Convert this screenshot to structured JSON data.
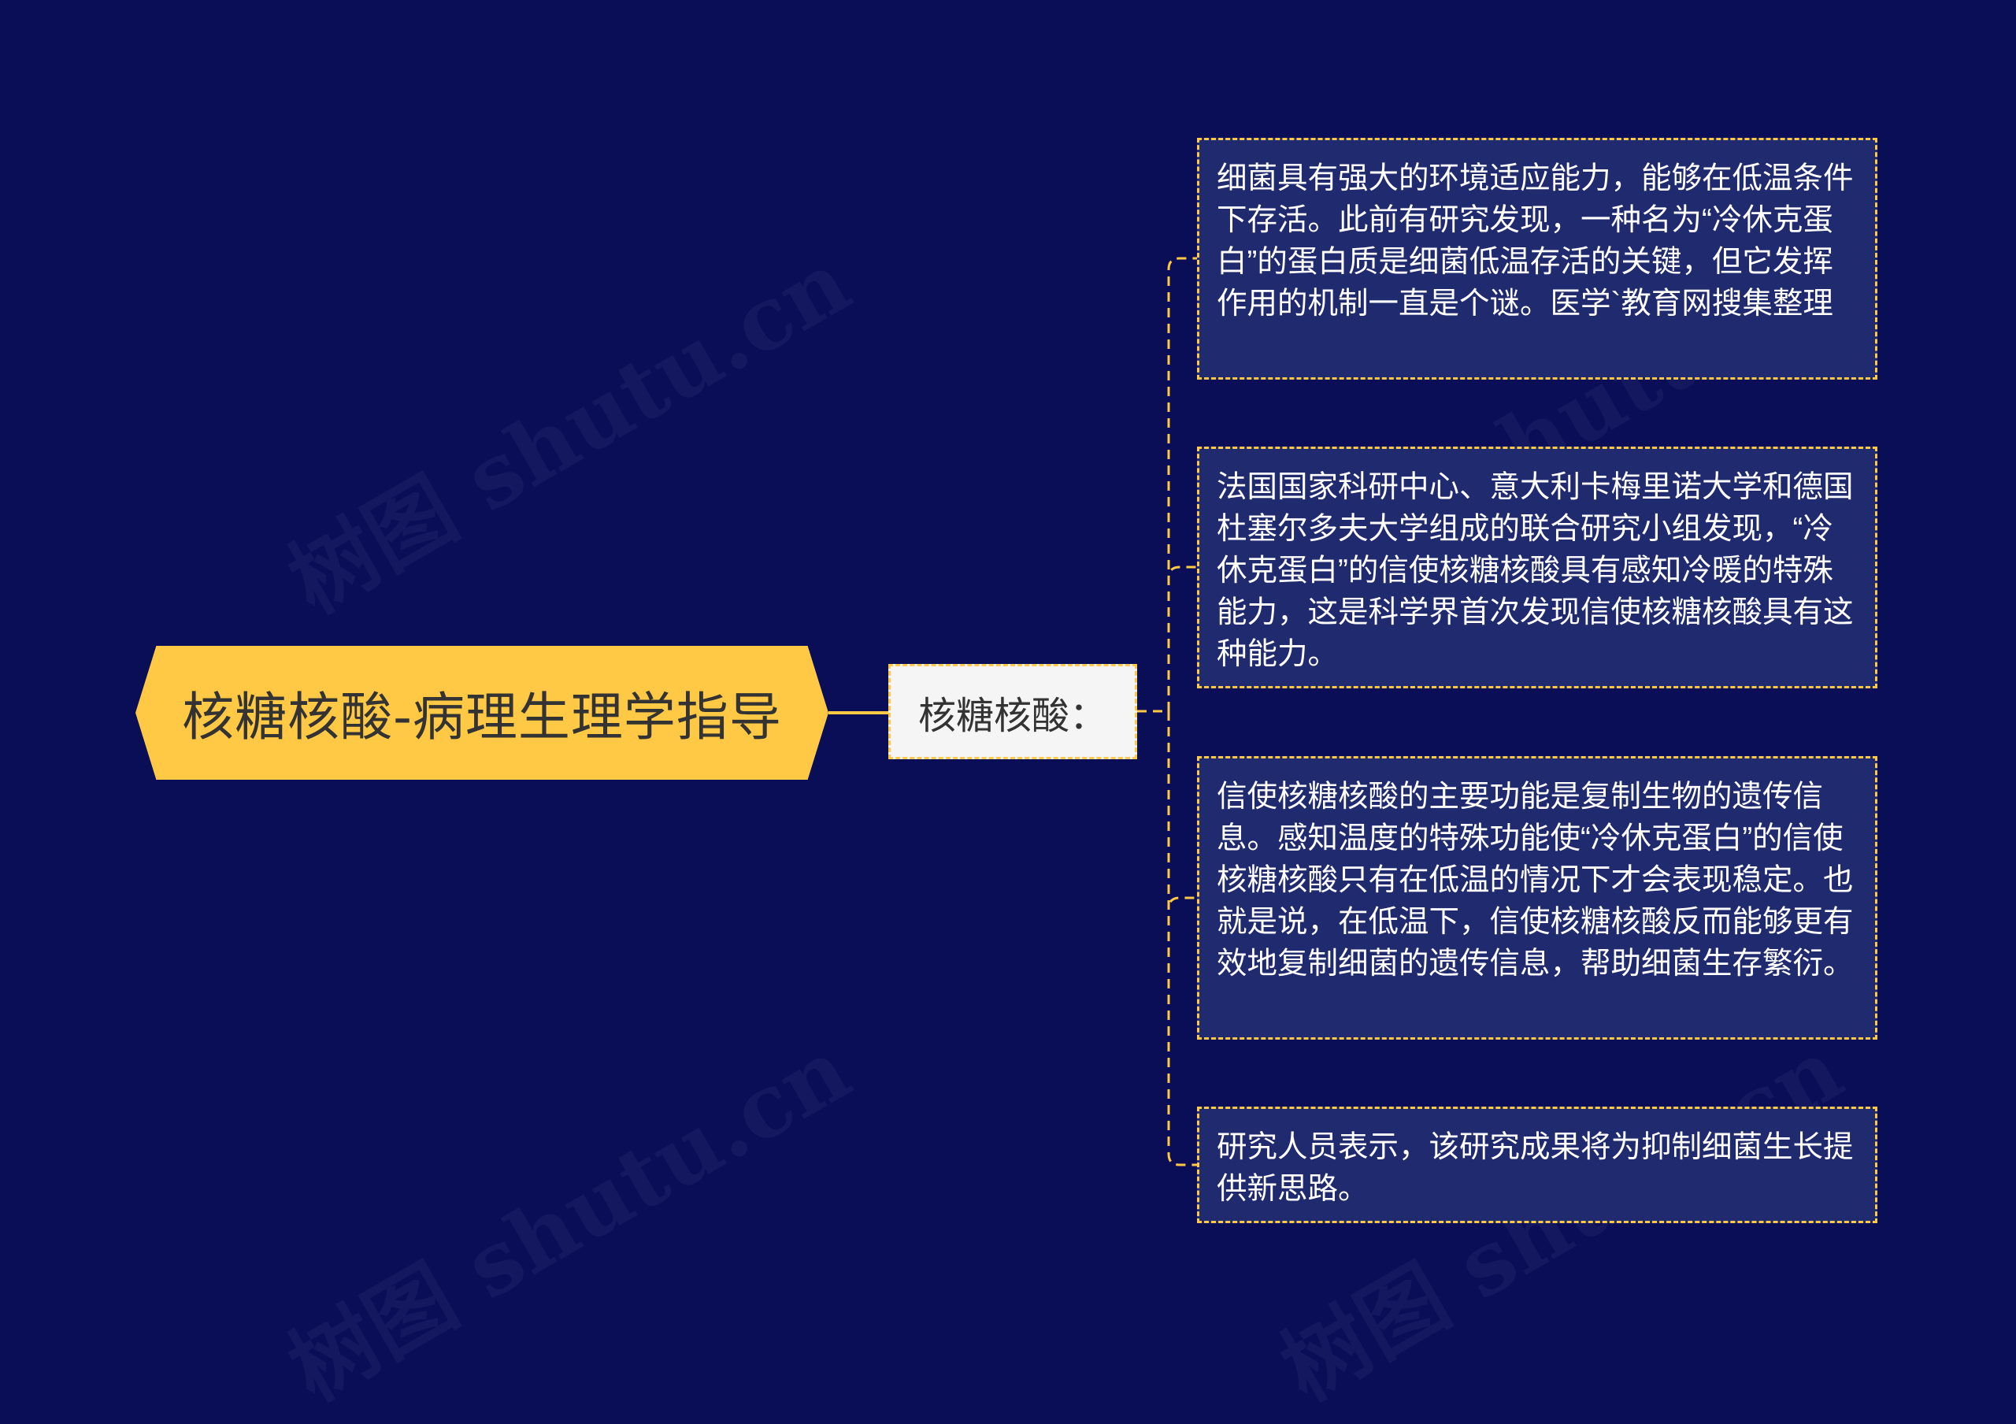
{
  "watermark": "树图 shutu.cn",
  "root": {
    "label": "核糖核酸-病理生理学指导"
  },
  "branch": {
    "label": "核糖核酸："
  },
  "leaves": [
    {
      "text": "细菌具有强大的环境适应能力，能够在低温条件下存活。此前有研究发现，一种名为“冷休克蛋白”的蛋白质是细菌低温存活的关键，但它发挥作用的机制一直是个谜。医学`教育网搜集整理"
    },
    {
      "text": "法国国家科研中心、意大利卡梅里诺大学和德国杜塞尔多夫大学组成的联合研究小组发现，“冷休克蛋白”的信使核糖核酸具有感知冷暖的特殊能力，这是科学界首次发现信使核糖核酸具有这种能力。"
    },
    {
      "text": "信使核糖核酸的主要功能是复制生物的遗传信息。感知温度的特殊功能使“冷休克蛋白”的信使核糖核酸只有在低温的情况下才会表现稳定。也就是说，在低温下，信使核糖核酸反而能够更有效地复制细菌的遗传信息，帮助细菌生存繁衍。"
    },
    {
      "text": "研究人员表示，该研究成果将为抑制细菌生长提供新思路。"
    }
  ],
  "colors": {
    "background": "#0a0e57",
    "accent": "#ffc845",
    "leaf_fill": "#202a6e",
    "branch_fill": "#f5f5f5"
  }
}
